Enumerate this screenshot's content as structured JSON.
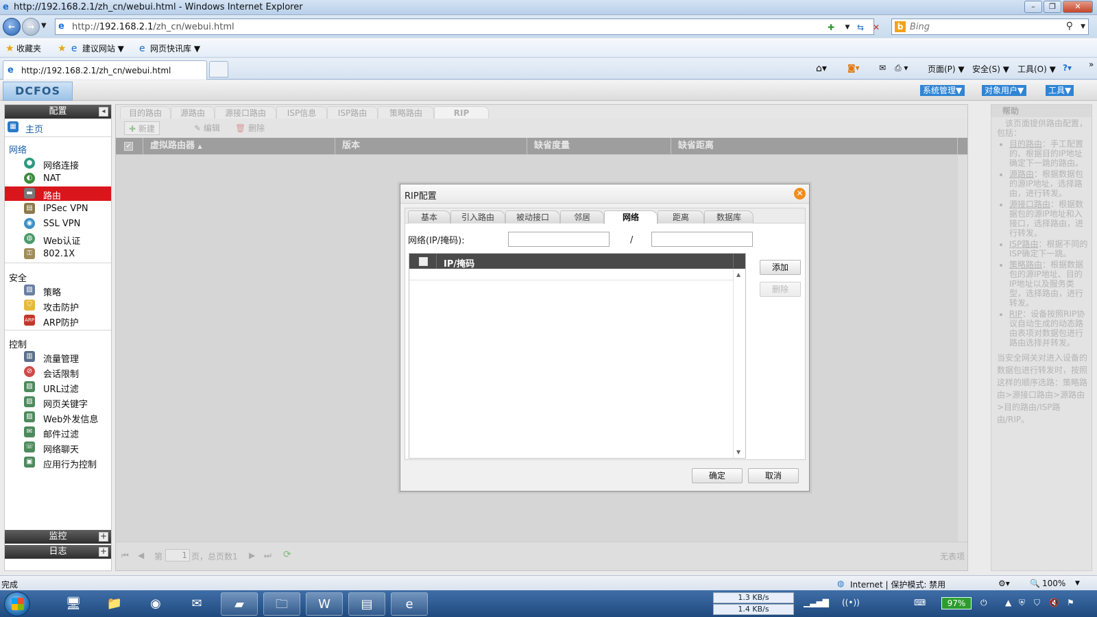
{
  "browser": {
    "window_title": "http://192.168.2.1/zh_cn/webui.html - Windows Internet Explorer",
    "address_prefix": "http://",
    "address_host": "192.168.2.1",
    "address_path": "/zh_cn/webui.html",
    "search_placeholder": "Bing",
    "favorites": [
      "收藏夹",
      "建议网站 ▼",
      "网页快讯库 ▼"
    ],
    "tab_title": "http://192.168.2.1/zh_cn/webui.html",
    "commands": [
      "页面(P) ▼",
      "安全(S) ▼",
      "工具(O) ▼"
    ]
  },
  "app": {
    "logo": "DCFOS",
    "top_menus": [
      "系统管理▼",
      "对象用户▼",
      "工具▼"
    ],
    "sidebar": {
      "header": "配置",
      "home": "主页",
      "sections": [
        {
          "title": "网络",
          "items": [
            "网络连接",
            "NAT",
            "路由",
            "IPSec VPN",
            "SSL VPN",
            "Web认证",
            "802.1X"
          ]
        },
        {
          "title": "安全",
          "items": [
            "策略",
            "攻击防护",
            "ARP防护"
          ]
        },
        {
          "title": "控制",
          "items": [
            "流量管理",
            "会话限制",
            "URL过滤",
            "网页关键字",
            "Web外发信息",
            "邮件过滤",
            "网络聊天",
            "应用行为控制"
          ]
        }
      ],
      "footer": [
        "监控",
        "日志"
      ],
      "active_item": "路由"
    },
    "main": {
      "tabs": [
        "目的路由",
        "源路由",
        "源接口路由",
        "ISP信息",
        "ISP路由",
        "策略路由",
        "RIP"
      ],
      "active_tab": "RIP",
      "toolbar": {
        "new": "新建",
        "edit": "编辑",
        "delete": "删除"
      },
      "columns": [
        "虚拟路由器",
        "版本",
        "缺省度量",
        "缺省距离"
      ],
      "pager": {
        "page_prefix": "第",
        "page_value": "1",
        "page_suffix": "页，总页数1",
        "empty": "无表项"
      }
    },
    "help": {
      "title": "帮助",
      "intro": "该页面提供路由配置，包括：",
      "items": [
        {
          "name": "目的路由",
          "desc": "：手工配置的、根据目的IP地址确定下一跳的路由。"
        },
        {
          "name": "源路由",
          "desc": "：根据数据包的源IP地址，选择路由，进行转发。"
        },
        {
          "name": "源接口路由",
          "desc": "：根据数据包的源IP地址和入接口，选择路由，进行转发。"
        },
        {
          "name": "ISP路由",
          "desc": "：根据不同的ISP确定下一跳。"
        },
        {
          "name": "策略路由",
          "desc": "：根据数据包的源IP地址、目的IP地址以及服务类型，选择路由，进行转发。"
        },
        {
          "name": "RIP",
          "desc": "：设备按照RIP协议自动生成的动态路由表项对数据包进行路由选择并转发。"
        }
      ],
      "footer": "当安全网关对进入设备的数据包进行转发时，按照这样的顺序选路：策略路由>源接口路由>源路由>目的路由/ISP路由/RIP。"
    }
  },
  "dialog": {
    "title": "RIP配置",
    "tabs": [
      "基本",
      "引入路由",
      "被动接口",
      "邻居",
      "网络",
      "距离",
      "数据库"
    ],
    "active_tab": "网络",
    "network_label": "网络(IP/掩码):",
    "slash": "/",
    "ip_value": "",
    "mask_value": "",
    "grid_header": "IP/掩码",
    "add": "添加",
    "delete": "删除",
    "ok": "确定",
    "cancel": "取消"
  },
  "status": {
    "left": "完成",
    "zone": "Internet | 保护模式: 禁用",
    "zoom": "100%"
  },
  "taskbar": {
    "download": "1.3 KB/s",
    "upload": "1.4 KB/s",
    "battery": "97%"
  }
}
